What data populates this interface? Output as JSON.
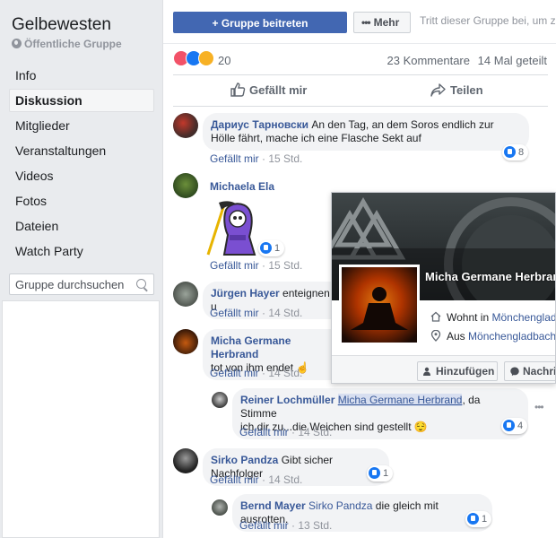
{
  "sidebar": {
    "group_name": "Gelbewesten",
    "group_type": "Öffentliche Gruppe",
    "nav": [
      "Info",
      "Diskussion",
      "Mitglieder",
      "Veranstaltungen",
      "Videos",
      "Fotos",
      "Dateien",
      "Watch Party"
    ],
    "active_index": 1,
    "search_placeholder": "Gruppe durchsuchen"
  },
  "header": {
    "join_label": "+ Gruppe beitreten",
    "more_label": "Mehr",
    "join_hint": "Tritt dieser Gruppe bei, um zu p"
  },
  "post": {
    "reaction_count": "20",
    "comment_count": "23 Kommentare",
    "share_count": "14 Mal geteilt",
    "like_action": "Gefällt mir",
    "share_action": "Teilen",
    "colors": {
      "accent": "#4267b2",
      "link": "#385898",
      "meta": "#90949c"
    }
  },
  "comments": [
    {
      "author": "Дариус Тарновски",
      "text": "An den Tag, an dem Soros endlich zur Hölle fährt, mache ich eine Flasche Sekt auf",
      "like_label": "Gefällt mir",
      "time": "15 Std.",
      "likes": "8"
    },
    {
      "author": "Michaela Ela",
      "sticker": "grim-reaper-sticker",
      "like_label": "Gefällt mir",
      "time": "15 Std.",
      "likes": "1"
    },
    {
      "author": "Jürgen Hayer",
      "text": "enteignen u",
      "like_label": "Gefällt mir",
      "time": "14 Std."
    },
    {
      "author": "Micha Germane Herbrand",
      "text": "tot von ihm endet",
      "emoji": "☝",
      "like_label": "Gefällt mir",
      "time": "14 Std."
    },
    {
      "author": "Reiner Lochmüller",
      "mention": "Micha Germane Herbrand",
      "text1": ", da Stimme",
      "text2": "ich dir zu...die Weichen sind gestellt",
      "emoji": "😌",
      "like_label": "Gefällt mir",
      "time": "14 Std.",
      "likes": "4"
    },
    {
      "author": "Sirko Pandza",
      "text": "Gibt sicher Nachfolger",
      "like_label": "Gefällt mir",
      "time": "14 Std.",
      "likes": "1"
    },
    {
      "author": "Bernd Mayer",
      "mention": "Sirko Pandza",
      "text": "die gleich mit ausrotten.",
      "like_label": "Gefällt mir",
      "time": "13 Std.",
      "likes": "1"
    }
  ],
  "hovercard": {
    "name": "Micha Germane Herbran",
    "lives_prefix": "Wohnt in",
    "lives_city": "Mönchengladb",
    "from_prefix": "Aus",
    "from_city": "Mönchengladbach",
    "add_label": "Hinzufügen",
    "message_label": "Nachri"
  }
}
